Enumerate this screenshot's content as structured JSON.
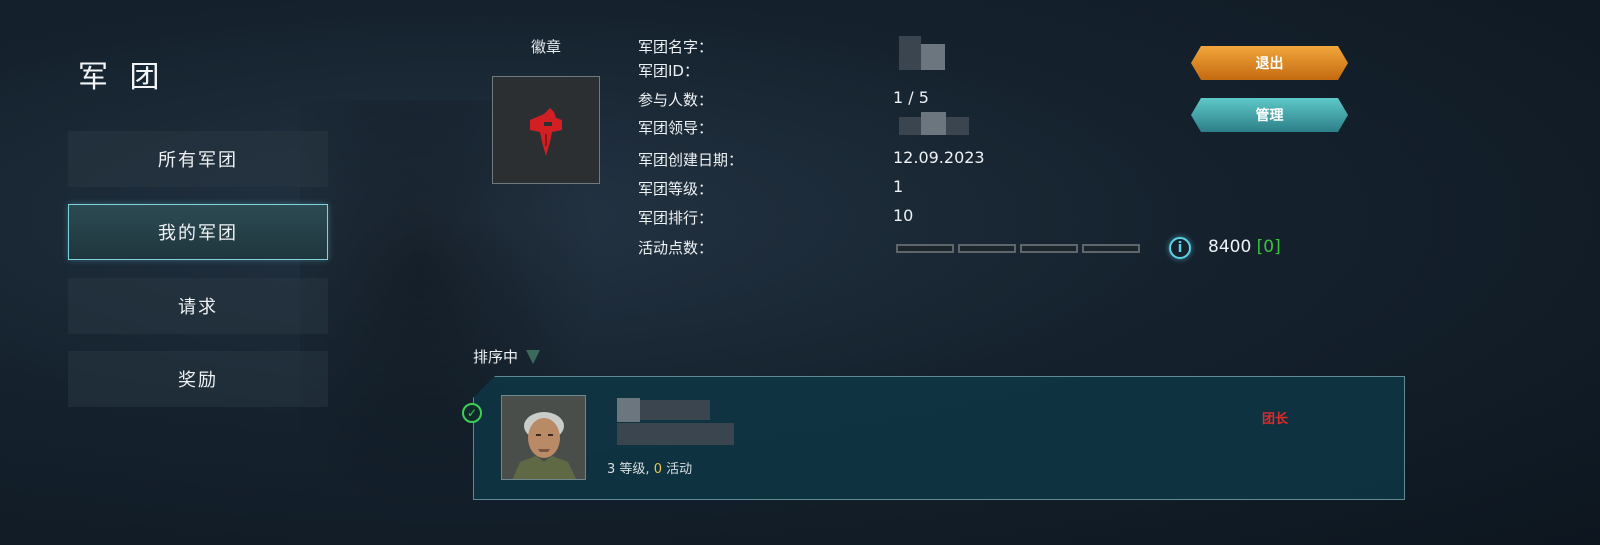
{
  "page": {
    "title": "军 团"
  },
  "nav": {
    "items": [
      {
        "label": "所有军团",
        "active": false
      },
      {
        "label": "我的军团",
        "active": true
      },
      {
        "label": "请求",
        "active": false
      },
      {
        "label": "奖励",
        "active": false
      }
    ]
  },
  "emblem": {
    "label": "徽章",
    "icon": "red-fist-dagger-icon"
  },
  "info": {
    "name_label": "军团名字：",
    "id_label": "军团ID：",
    "members_label": "参与人数：",
    "members_value": "1 / 5",
    "leader_label": "军团领导：",
    "created_label": "军团创建日期：",
    "created_value": "12.09.2023",
    "level_label": "军团等级：",
    "level_value": "1",
    "rank_label": "军团排行：",
    "rank_value": "10",
    "activity_label": "活动点数：",
    "activity_progress": 0,
    "activity_points": "8400",
    "activity_extra": "[0]"
  },
  "actions": {
    "exit_label": "退出",
    "manage_label": "管理"
  },
  "sort": {
    "label": "排序中"
  },
  "member": {
    "level_value": "3",
    "level_suffix": "等级,",
    "activity_value": "0",
    "activity_suffix": "活动",
    "role": "团长"
  },
  "colors": {
    "accent_teal": "#7fd3da",
    "exit_orange": "#e08a24",
    "manage_teal": "#3fa5ad",
    "role_red": "#e02a2a",
    "points_green": "#3dc23d"
  }
}
